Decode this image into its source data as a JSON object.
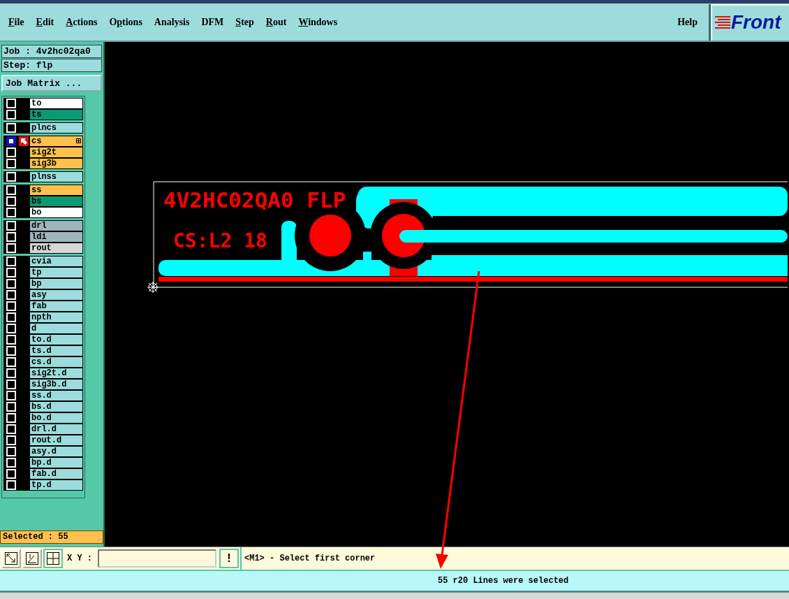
{
  "menu": [
    {
      "mnemonic": "F",
      "after": "ile"
    },
    {
      "mnemonic": "E",
      "after": "dit"
    },
    {
      "mnemonic": "A",
      "after": "ctions"
    },
    {
      "before": "O",
      "mnemonic": "p",
      "after": "tions"
    },
    {
      "before": "Analysis"
    },
    {
      "before": "DFM"
    },
    {
      "mnemonic": "S",
      "after": "tep"
    },
    {
      "mnemonic": "R",
      "after": "out"
    },
    {
      "mnemonic": "W",
      "after": "indows"
    }
  ],
  "help_menu": {
    "label": "Help"
  },
  "logo": {
    "text": "Front"
  },
  "job": "Job : 4v2hc02qa0",
  "step": "Step: flp",
  "job_matrix_button": "Job Matrix ...",
  "layer_groups": [
    {
      "layers": [
        {
          "name": "to",
          "color": "#ffffff",
          "work": false
        },
        {
          "name": "ts",
          "color": "#0b9a74",
          "work": false
        }
      ]
    },
    {
      "layers": [
        {
          "name": "plncs",
          "color": "#9ddcdc",
          "work": false
        }
      ]
    },
    {
      "layers": [
        {
          "name": "cs",
          "color": "#ffc04c",
          "work": true
        },
        {
          "name": "sig2t",
          "color": "#ffc04c",
          "work": false
        },
        {
          "name": "sig3b",
          "color": "#ffc04c",
          "work": false
        }
      ]
    },
    {
      "layers": [
        {
          "name": "plnss",
          "color": "#9ddcdc",
          "work": false
        }
      ]
    },
    {
      "layers": [
        {
          "name": "ss",
          "color": "#ffc04c",
          "work": false
        },
        {
          "name": "bs",
          "color": "#0b9a74",
          "work": false
        },
        {
          "name": "bo",
          "color": "#ffffff",
          "work": false
        }
      ]
    },
    {
      "layers": [
        {
          "name": "drl",
          "color": "#9fb5bd",
          "work": false
        },
        {
          "name": "ldi",
          "color": "#9fb5bd",
          "work": false
        },
        {
          "name": "rout",
          "color": "#d6d6d6",
          "work": false
        }
      ]
    },
    {
      "layers": [
        {
          "name": "cvia",
          "color": "#9ddcdc",
          "work": false
        },
        {
          "name": "tp",
          "color": "#9ddcdc",
          "work": false
        },
        {
          "name": "bp",
          "color": "#9ddcdc",
          "work": false
        },
        {
          "name": "asy",
          "color": "#9ddcdc",
          "work": false
        },
        {
          "name": "fab",
          "color": "#9ddcdc",
          "work": false
        },
        {
          "name": "npth",
          "color": "#9ddcdc",
          "work": false
        },
        {
          "name": "d",
          "color": "#9ddcdc",
          "work": false
        },
        {
          "name": "to.d",
          "color": "#9ddcdc",
          "work": false
        },
        {
          "name": "ts.d",
          "color": "#9ddcdc",
          "work": false
        },
        {
          "name": "cs.d",
          "color": "#9ddcdc",
          "work": false
        },
        {
          "name": "sig2t.d",
          "color": "#9ddcdc",
          "work": false
        },
        {
          "name": "sig3b.d",
          "color": "#9ddcdc",
          "work": false
        },
        {
          "name": "ss.d",
          "color": "#9ddcdc",
          "work": false
        },
        {
          "name": "bs.d",
          "color": "#9ddcdc",
          "work": false
        },
        {
          "name": "bo.d",
          "color": "#9ddcdc",
          "work": false
        },
        {
          "name": "drl.d",
          "color": "#9ddcdc",
          "work": false
        },
        {
          "name": "rout.d",
          "color": "#9ddcdc",
          "work": false
        },
        {
          "name": "asy.d",
          "color": "#9ddcdc",
          "work": false
        },
        {
          "name": "bp.d",
          "color": "#9ddcdc",
          "work": false
        },
        {
          "name": "fab.d",
          "color": "#9ddcdc",
          "work": false
        },
        {
          "name": "tp.d",
          "color": "#9ddcdc",
          "work": false
        }
      ]
    }
  ],
  "selected_count": "Selected : 55",
  "canvas": {
    "labels": [
      "4V2HC02QA0 FLP",
      "CS:L2 18"
    ]
  },
  "toolbar": {
    "coord_label": "X Y :",
    "alert_button": "!",
    "prompt": "<M1> - Select first corner"
  },
  "status_bar": "55 r20 Lines were selected"
}
